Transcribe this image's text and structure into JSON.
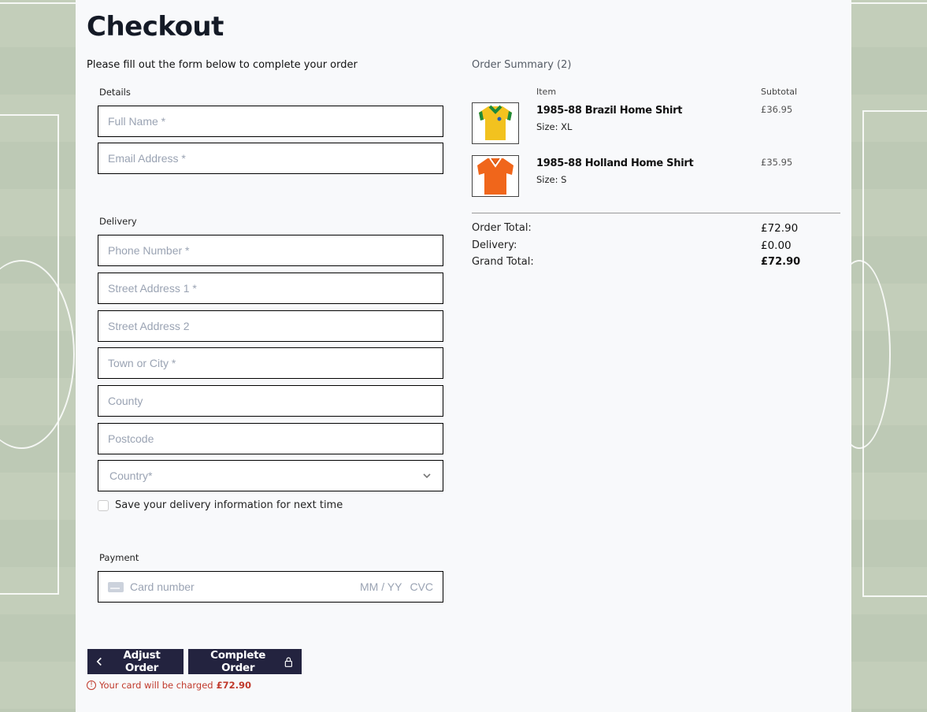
{
  "page": {
    "title": "Checkout",
    "intro": "Please fill out the form below to complete your order"
  },
  "details": {
    "label": "Details",
    "full_name_placeholder": "Full Name *",
    "email_placeholder": "Email Address *"
  },
  "delivery": {
    "label": "Delivery",
    "phone_placeholder": "Phone Number *",
    "street1_placeholder": "Street Address 1 *",
    "street2_placeholder": "Street Address 2",
    "town_placeholder": "Town or City *",
    "county_placeholder": "County",
    "postcode_placeholder": "Postcode",
    "country_placeholder": "Country*",
    "save_info_label": "Save your delivery information for next time"
  },
  "payment": {
    "label": "Payment",
    "card_number_placeholder": "Card number",
    "card_exp_placeholder": "MM / YY",
    "card_cvc_placeholder": "CVC"
  },
  "buttons": {
    "adjust": "Adjust Order",
    "complete": "Complete Order"
  },
  "charge_note": {
    "text": "Your card will be charged",
    "amount": "£72.90"
  },
  "summary": {
    "title": "Order Summary (2)",
    "col_item": "Item",
    "col_subtotal": "Subtotal",
    "items": [
      {
        "name": "1985-88 Brazil Home Shirt",
        "size": "Size: XL",
        "subtotal": "£36.95",
        "color": "#f2c21f",
        "trim": "#1e8a3a"
      },
      {
        "name": "1985-88 Holland Home Shirt",
        "size": "Size: S",
        "subtotal": "£35.95",
        "color": "#f0661b",
        "trim": "#ffffff"
      }
    ],
    "order_total_label": "Order Total:",
    "order_total": "£72.90",
    "delivery_label": "Delivery:",
    "delivery_value": "£0.00",
    "grand_total_label": "Grand Total:",
    "grand_total": "£72.90"
  },
  "colors": {
    "button_bg": "#23233f",
    "error": "#c0392b",
    "background_pitch": "#c4cfbc"
  }
}
